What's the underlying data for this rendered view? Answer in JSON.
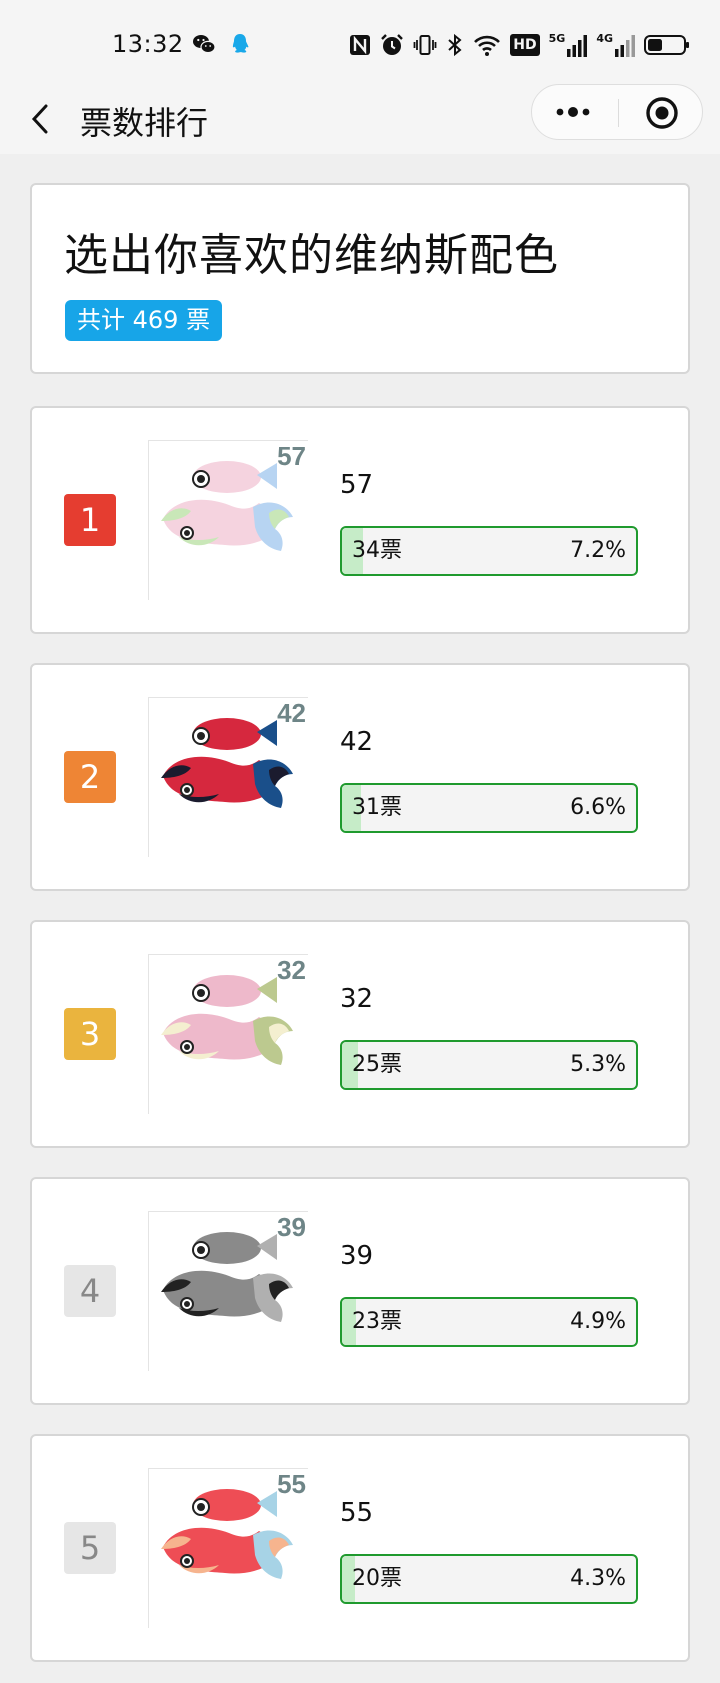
{
  "status_bar": {
    "time": "13:32",
    "app_icons": [
      "wechat-icon",
      "qq-icon"
    ],
    "indicators": [
      "nfc-icon",
      "alarm-icon",
      "vibrate-icon",
      "bluetooth-icon",
      "wifi-icon",
      "hd-icon",
      "5g-signal-icon",
      "4g-signal-icon",
      "battery-icon"
    ],
    "hd_label": "HD",
    "net_5g_label": "5G",
    "net_4g_label": "4G"
  },
  "nav": {
    "title": "票数排行",
    "back_icon": "chevron-left-icon",
    "menu_icon": "more-dots-icon",
    "close_icon": "target-circle-icon"
  },
  "header": {
    "title": "选出你喜欢的维纳斯配色",
    "total_label": "共计 469 票",
    "badge_color": "#17a5e8"
  },
  "colors": {
    "rank1": "#e53d30",
    "rank2": "#ee8535",
    "rank3": "#eab43e",
    "rank_other": "#e6e6e6",
    "bar_border": "#1f9a2e",
    "bar_fill": "#c6ecc8"
  },
  "rankings": [
    {
      "rank": "1",
      "thumb_number": "57",
      "name": "57",
      "votes": "34票",
      "percent": "7.2%",
      "fraction": 0.072
    },
    {
      "rank": "2",
      "thumb_number": "42",
      "name": "42",
      "votes": "31票",
      "percent": "6.6%",
      "fraction": 0.066
    },
    {
      "rank": "3",
      "thumb_number": "32",
      "name": "32",
      "votes": "25票",
      "percent": "5.3%",
      "fraction": 0.053
    },
    {
      "rank": "4",
      "thumb_number": "39",
      "name": "39",
      "votes": "23票",
      "percent": "4.9%",
      "fraction": 0.049
    },
    {
      "rank": "5",
      "thumb_number": "55",
      "name": "55",
      "votes": "20票",
      "percent": "4.3%",
      "fraction": 0.043
    }
  ]
}
